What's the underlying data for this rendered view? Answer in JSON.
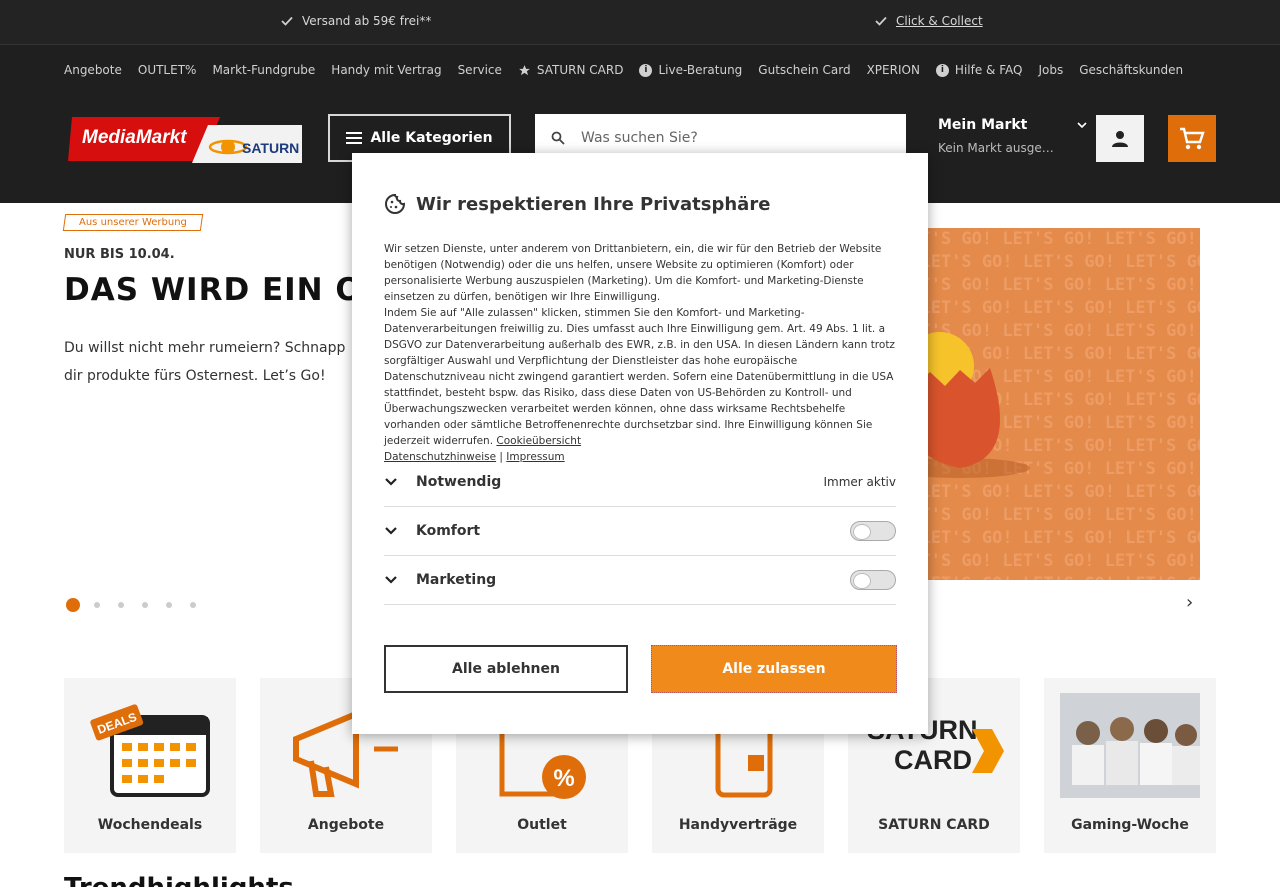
{
  "topbar": {
    "usp1": "Versand ab 59€ frei**",
    "usp2": "Click & Collect"
  },
  "subnav": {
    "items": [
      "Angebote",
      "OUTLET%",
      "Markt-Fundgrube",
      "Handy mit Vertrag",
      "Service",
      "SATURN CARD",
      "Live-Beratung",
      "Gutschein Card",
      "XPERION",
      "Hilfe & FAQ",
      "Jobs",
      "Geschäftskunden"
    ]
  },
  "header": {
    "logo_text_left": "MediaMarkt",
    "logo_text_right": "SATURN",
    "categories_label": "Alle Kategorien",
    "search_placeholder": "Was suchen Sie?",
    "market_title": "Mein Markt",
    "market_sub": "Kein Markt ausgewählt"
  },
  "hero": {
    "ad_tag": "Aus unserer Werbung",
    "kicker": "NUR BIS 10.04.",
    "headline": "DAS WIRD EIN OST",
    "lead": "Du willst nicht mehr rumeiern? Schnapp dir produkte fürs Osternest. Let’s Go!",
    "pattern_text": "LET'S GO!"
  },
  "tiles": [
    {
      "label": "Wochendeals",
      "badge": "DEALS"
    },
    {
      "label": "Angebote"
    },
    {
      "label": "Outlet"
    },
    {
      "label": "Handyverträge"
    },
    {
      "label": "SATURN CARD",
      "logo_line1": "SATURN",
      "logo_line2": "CARD"
    },
    {
      "label": "Gaming-Woche"
    }
  ],
  "trend_title": "Trendhighlights",
  "consent": {
    "title": "Wir respektieren Ihre Privatsphäre",
    "p1": "Wir setzen Dienste, unter anderem von Drittanbietern, ein, die wir für den Betrieb der Website benötigen (Notwendig) oder die uns helfen, unsere Website zu optimieren (Komfort) oder personalisierte Werbung auszuspielen (Marketing). Um die Komfort- und Marketing-Dienste einsetzen zu dürfen, benötigen wir Ihre Einwilligung.",
    "p2": "Indem Sie auf \"Alle zulassen\" klicken, stimmen Sie den Komfort- und Marketing-Datenverarbeitungen freiwillig zu. Dies umfasst auch Ihre Einwilligung gem. Art. 49 Abs. 1 lit. a DSGVO zur Datenverarbeitung außerhalb des EWR, z.B. in den USA. In diesen Ländern kann trotz sorgfältiger Auswahl und Verpflichtung der Dienstleister das hohe europäische Datenschutzniveau nicht zwingend garantiert werden. Sofern eine Datenübermittlung in die USA stattfindet, besteht bspw. das Risiko, dass diese Daten von US-Behörden zu Kontroll- und Überwachungszwecken verarbeitet werden können, ohne dass wirksame Rechtsbehelfe vorhanden oder sämtliche Betroffenenrechte durchsetzbar sind. Ihre Einwilligung können Sie jederzeit widerrufen.",
    "link_cookie": "Cookieübersicht",
    "link_privacy": "Datenschutzhinweise",
    "separator": "|",
    "link_imprint": "Impressum",
    "categories": [
      {
        "name": "Notwendig",
        "status": "Immer aktiv"
      },
      {
        "name": "Komfort",
        "enabled": false
      },
      {
        "name": "Marketing",
        "enabled": false
      }
    ],
    "reject_label": "Alle ablehnen",
    "accept_label": "Alle zulassen"
  },
  "colors": {
    "brand_orange": "#df6e0a",
    "accept_orange": "#f08a1a",
    "header_bg": "#1f1f1f"
  }
}
